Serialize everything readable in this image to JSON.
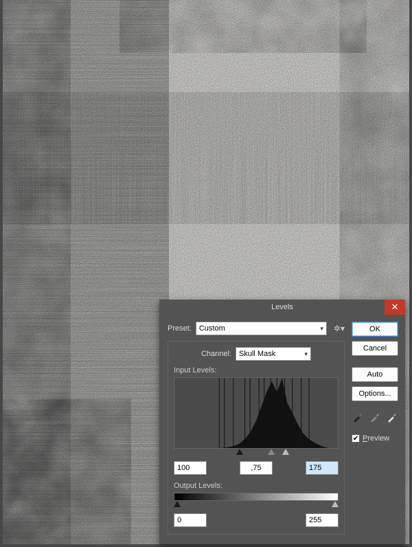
{
  "dialog": {
    "title": "Levels",
    "preset_label": "Preset:",
    "preset_value": "Custom",
    "channel_label": "Channel:",
    "channel_value": "Skull Mask",
    "input_levels_label": "Input Levels:",
    "output_levels_label": "Output Levels:",
    "input_black": "100",
    "input_gamma": ",75",
    "input_white": "175",
    "output_black": "0",
    "output_white": "255",
    "buttons": {
      "ok": "OK",
      "cancel": "Cancel",
      "auto": "Auto",
      "options": "Options..."
    },
    "preview_label": "Preview",
    "preview_checked": true
  },
  "chart_data": {
    "type": "bar",
    "title": "",
    "xlabel": "",
    "ylabel": "",
    "xlim": [
      0,
      255
    ],
    "ylim": [
      0,
      100
    ],
    "categories": [
      0,
      8,
      16,
      24,
      32,
      40,
      48,
      56,
      64,
      72,
      80,
      88,
      96,
      104,
      112,
      120,
      128,
      136,
      144,
      152,
      160,
      168,
      176,
      184,
      192,
      200,
      208,
      216,
      224,
      232,
      240,
      248,
      255
    ],
    "values": [
      0,
      0,
      0,
      0,
      0,
      0,
      0,
      0,
      0,
      0,
      1,
      2,
      4,
      8,
      15,
      25,
      40,
      60,
      80,
      95,
      80,
      100,
      65,
      50,
      35,
      22,
      14,
      9,
      5,
      2,
      0,
      0,
      0
    ],
    "spikes": [
      70,
      78,
      92,
      110,
      118,
      132,
      140,
      150,
      160,
      172,
      184,
      198,
      210
    ]
  }
}
